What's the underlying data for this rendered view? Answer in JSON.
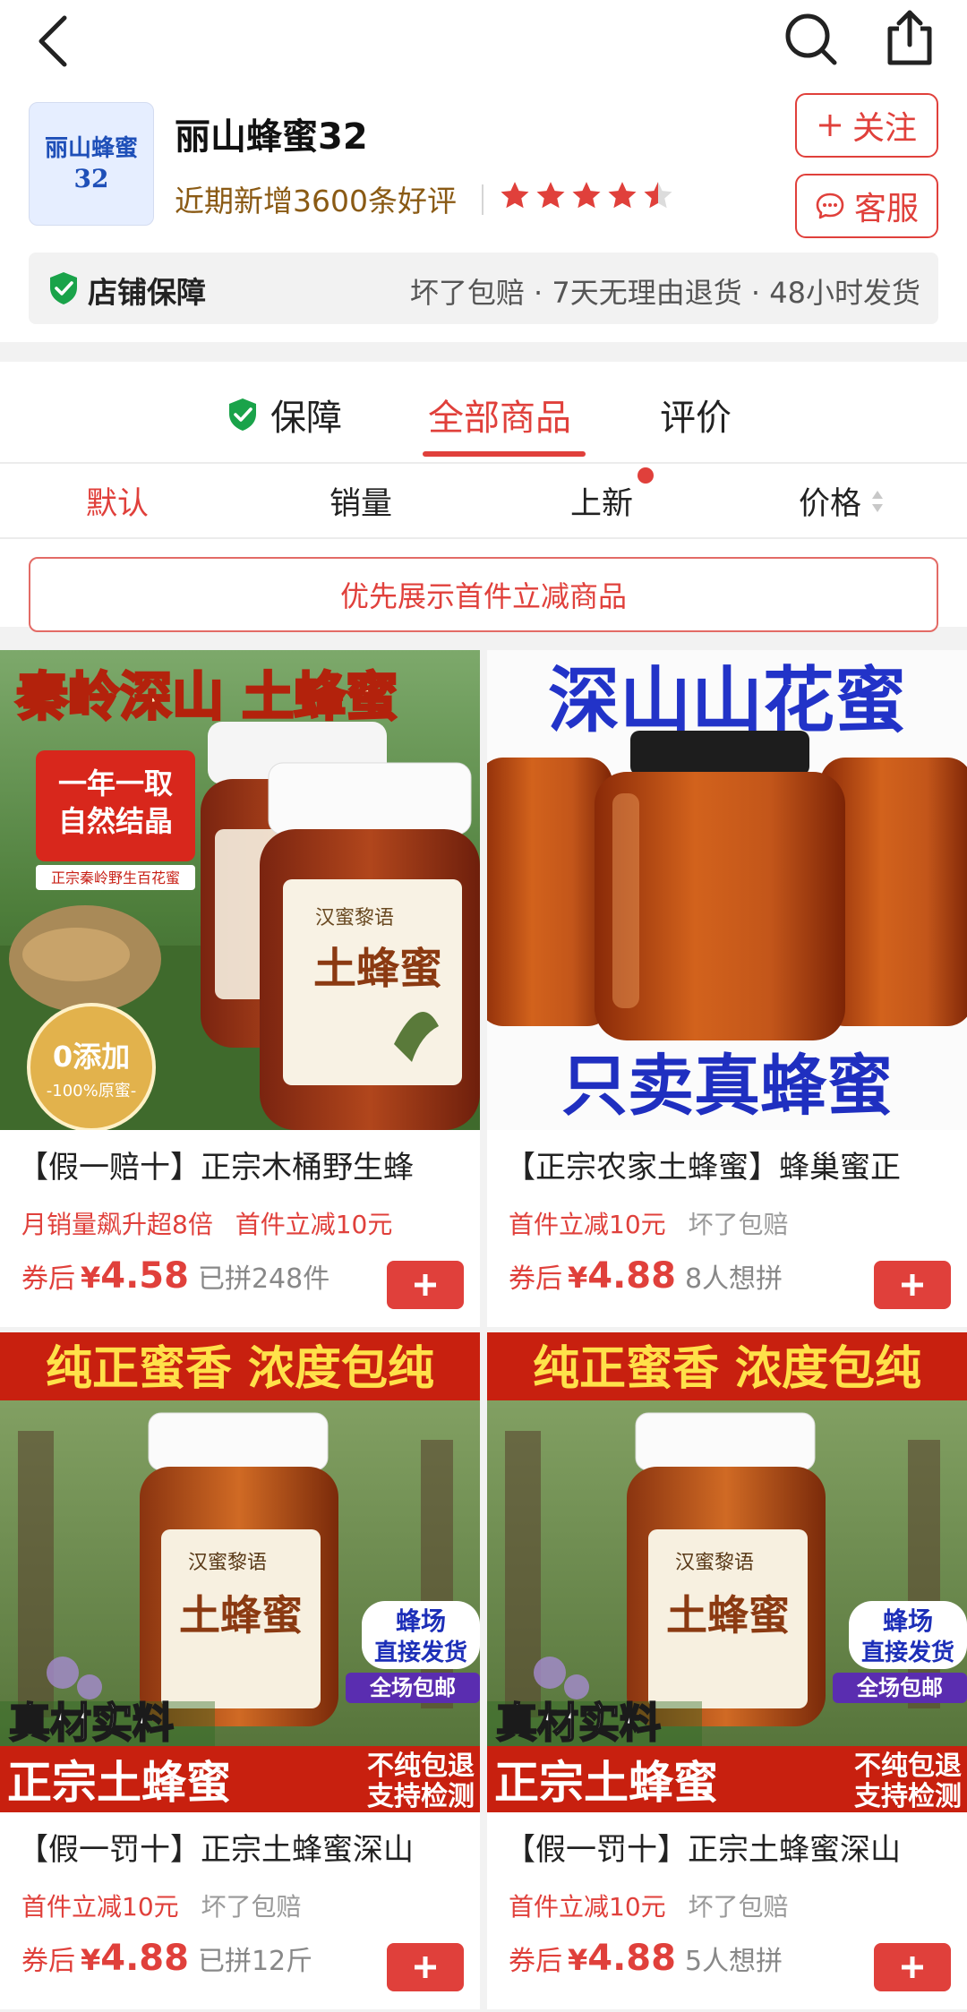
{
  "shop": {
    "logo_line1": "丽山蜂蜜",
    "logo_line2": "32",
    "name": "丽山蜂蜜32",
    "review_summary": "近期新增3600条好评",
    "rating": 4.5,
    "follow_label": "关注",
    "service_label": "客服"
  },
  "guarantee": {
    "title": "店铺保障",
    "desc": "坏了包赔 · 7天无理由退货 · 48小时发货"
  },
  "tabs": [
    {
      "label": "保障"
    },
    {
      "label": "全部商品"
    },
    {
      "label": "评价"
    }
  ],
  "sort": {
    "default": "默认",
    "sales": "销量",
    "new": "上新",
    "price": "价格"
  },
  "filter_label": "优先展示首件立减商品",
  "products": [
    {
      "title": "【假一赔十】正宗木桶野生蜂",
      "tag1": "月销量飙升超8倍",
      "tag2": "首件立减10元",
      "price_prefix": "券后",
      "yen": "¥",
      "price": "4.58",
      "sold": "已拼248件",
      "image": {
        "headline": "秦岭深山 土蜂蜜",
        "badge1": "一年一取",
        "badge2": "自然结晶",
        "badge3": "正宗秦岭野生百花蜜",
        "seal1": "0添加",
        "seal2": "-100%原蜜-",
        "jar_brand": "汉蜜黎语",
        "jar_label": "土蜂蜜"
      }
    },
    {
      "title": "【正宗农家土蜂蜜】蜂巢蜜正",
      "tag1": "首件立减10元",
      "tag2": "坏了包赔",
      "price_prefix": "券后",
      "yen": "¥",
      "price": "4.88",
      "sold": "8人想拼",
      "image": {
        "headline": "深山山花蜜",
        "footer": "只卖真蜂蜜"
      }
    },
    {
      "title": "【假一罚十】正宗土蜂蜜深山",
      "tag1": "首件立减10元",
      "tag2": "坏了包赔",
      "price_prefix": "券后",
      "yen": "¥",
      "price": "4.88",
      "sold": "已拼12斤",
      "image": {
        "headline": "纯正蜜香 浓度包纯",
        "badge1": "蜂场",
        "badge2": "直接发货",
        "badge3": "全场包邮",
        "left1": "真材实料",
        "bottom1": "正宗土蜂蜜",
        "bottom2": "不纯包退",
        "bottom3": "支持检测",
        "jar_brand": "汉蜜黎语",
        "jar_label": "土蜂蜜"
      }
    },
    {
      "title": "【假一罚十】正宗土蜂蜜深山",
      "tag1": "首件立减10元",
      "tag2": "坏了包赔",
      "price_prefix": "券后",
      "yen": "¥",
      "price": "4.88",
      "sold": "5人想拼",
      "image": {
        "headline": "纯正蜜香 浓度包纯",
        "badge1": "蜂场",
        "badge2": "直接发货",
        "badge3": "全场包邮",
        "left1": "真材实料",
        "bottom1": "正宗土蜂蜜",
        "bottom2": "不纯包退",
        "bottom3": "支持检测",
        "jar_brand": "汉蜜黎语",
        "jar_label": "土蜂蜜"
      }
    }
  ],
  "colors": {
    "accent": "#e0403b",
    "gold": "#8a5a14",
    "guarantee_green": "#1aa34a"
  }
}
